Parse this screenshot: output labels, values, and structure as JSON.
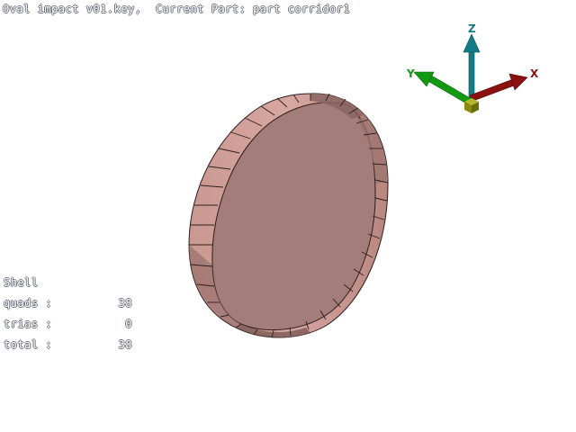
{
  "header": {
    "title": "Oval impact v01.key,  Current Part: part corridor1"
  },
  "colors": {
    "ring_face_light": "#d4a09a",
    "ring_face_dark": "#8a6560",
    "axis_x": "#8b1010",
    "axis_y": "#129a12",
    "axis_z": "#127c86",
    "axis_origin": "#8a8a10"
  },
  "triad": {
    "x_label": "X",
    "y_label": "Y",
    "z_label": "Z"
  },
  "stats": {
    "heading": "Shell",
    "rows": [
      {
        "label": "quads :",
        "value": "38"
      },
      {
        "label": "trias :",
        "value": "0"
      },
      {
        "label": "total :",
        "value": "38"
      }
    ]
  }
}
